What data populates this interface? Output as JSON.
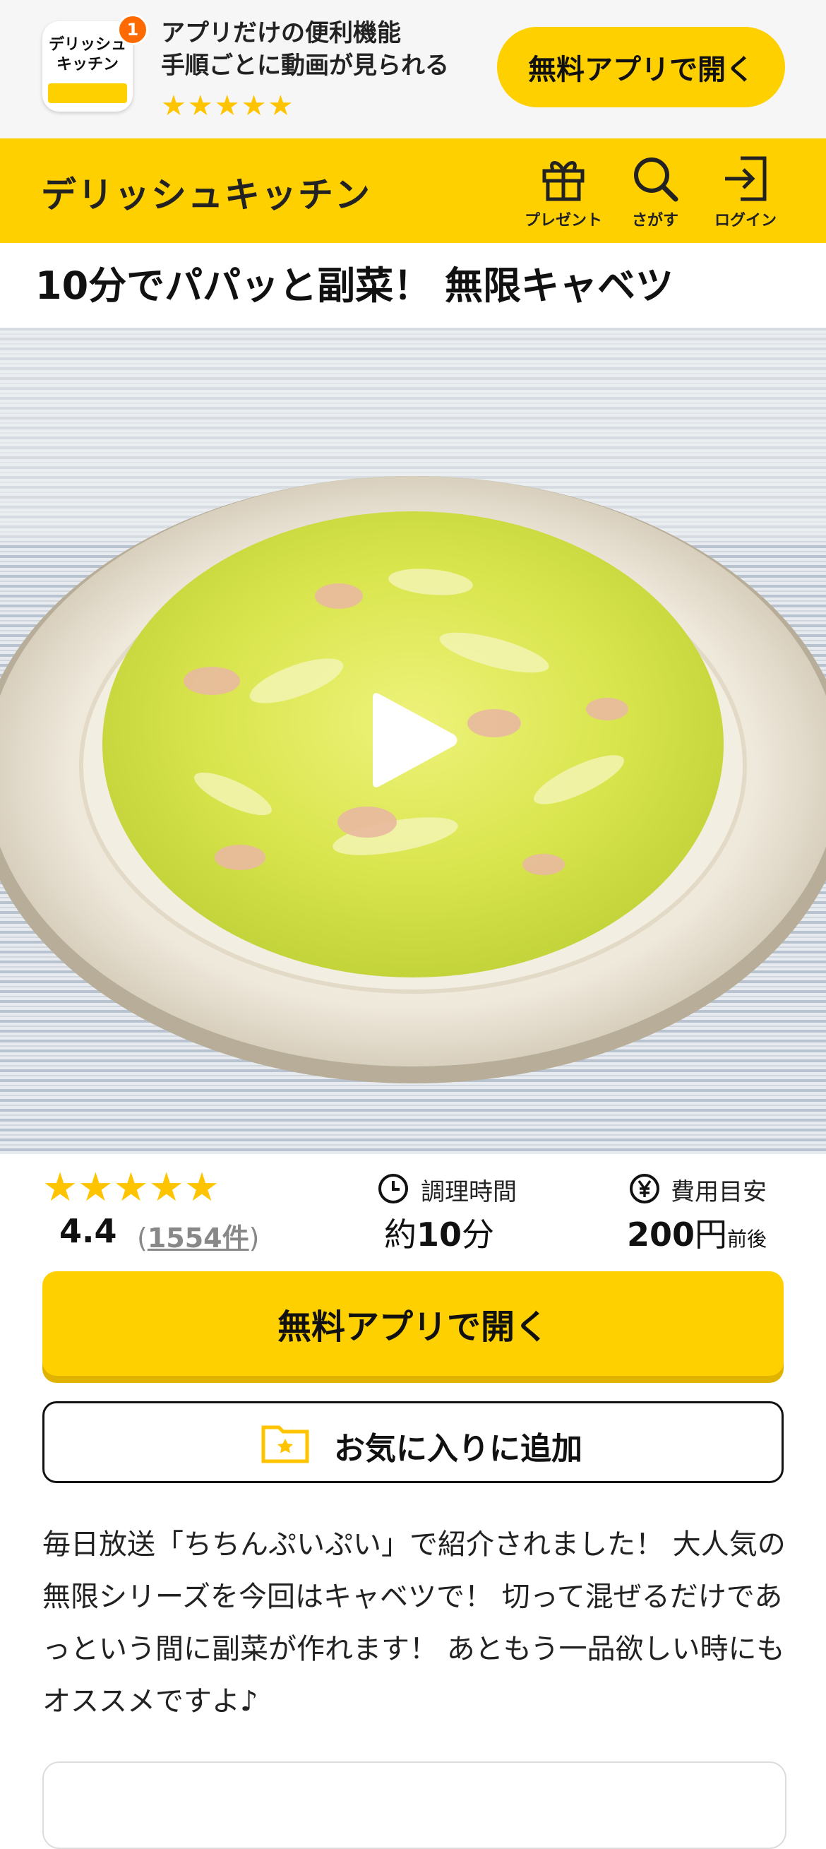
{
  "app_banner": {
    "icon_text": "デリッシュ\nキッチン",
    "badge": "1",
    "line1": "アプリだけの便利機能",
    "line2": "手順ごとに動画が見られる",
    "stars": "★★★★★",
    "open_label": "無料アプリで開く"
  },
  "header": {
    "logo": "デリッシュキッチン",
    "present": "プレゼント",
    "search": "さがす",
    "login": "ログイン"
  },
  "recipe": {
    "title": "10分でパパッと副菜！ 無限キャベツ",
    "stars": "★★★★★",
    "rating": "4.4",
    "count_open": "(",
    "count": "1554件",
    "count_close": ")",
    "time_label": "調理時間",
    "time_prefix": "約",
    "time_value": "10",
    "time_unit": "分",
    "cost_label": "費用目安",
    "cost_value": "200",
    "cost_unit": "円",
    "cost_suffix": "前後",
    "open_app": "無料アプリで開く",
    "favorite": "お気に入りに追加",
    "description": "毎日放送「ちちんぷいぷい」で紹介されました！ 大人気の無限シリーズを今回はキャベツで！ 切って混ぜるだけであっという間に副菜が作れます！ あともう一品欲しい時にもオススメですよ♪"
  },
  "colors": {
    "brand_yellow": "#ffd000",
    "star": "#ffc400",
    "badge": "#ff6a00"
  }
}
